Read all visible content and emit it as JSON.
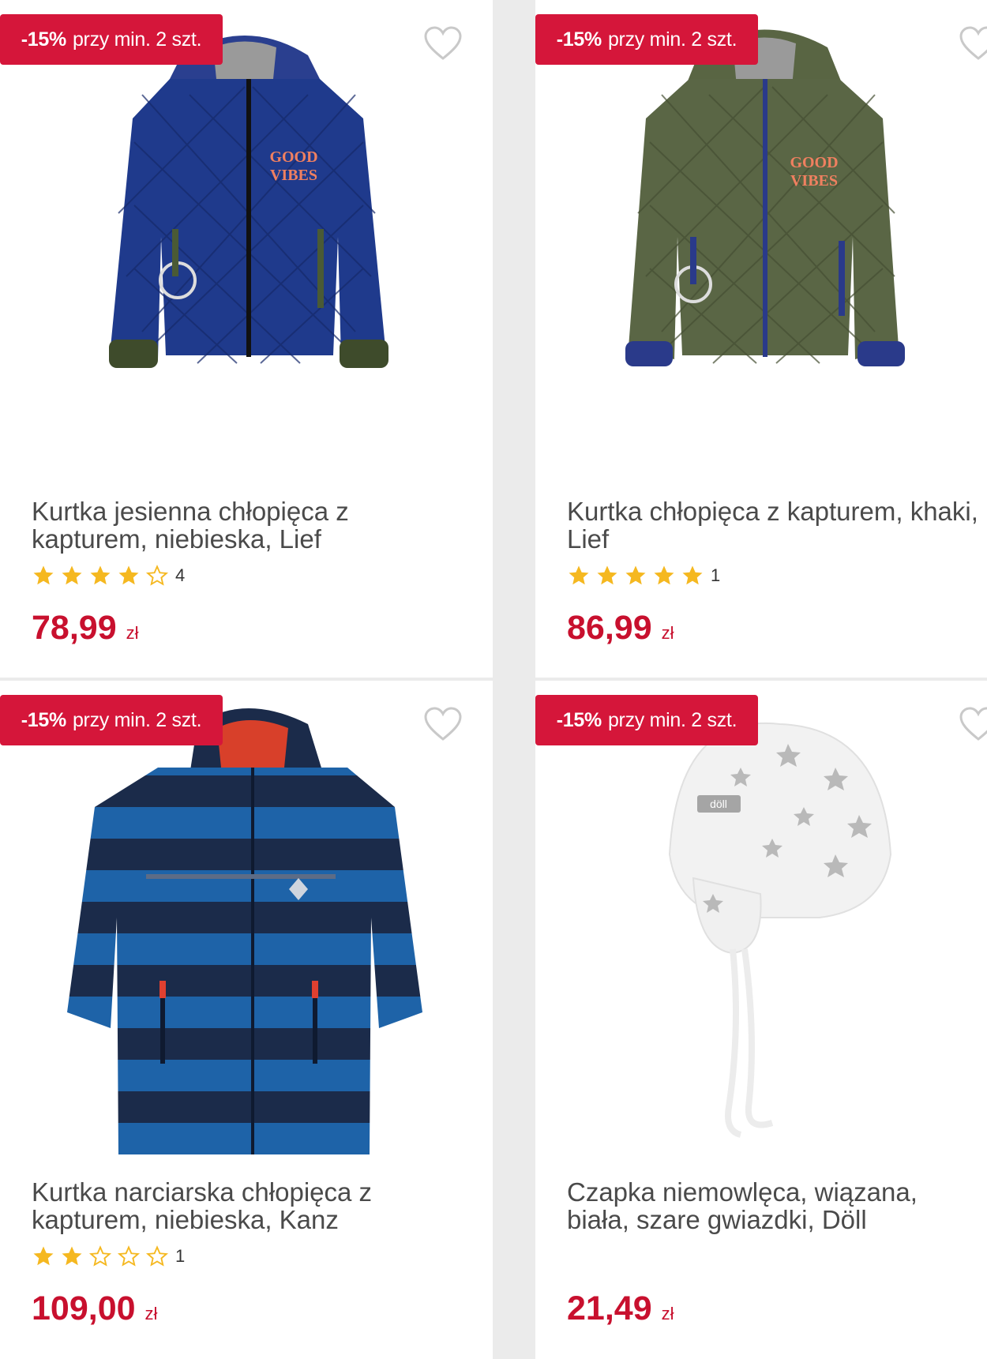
{
  "badge": {
    "pct": "-15%",
    "text": "przy min. 2 szt."
  },
  "colors": {
    "accent": "#d5163a",
    "price": "#c8102e",
    "star": "#f5b820"
  },
  "products": [
    {
      "title_line1": "Kurtka jesienna chłopięca z",
      "title_line2": "kapturem, niebieska, Lief",
      "rating": 4,
      "rating_count": "4",
      "price": "78,99",
      "currency": "zł",
      "image": "navy-quilted-jacket"
    },
    {
      "title_line1": "Kurtka chłopięca z kapturem, khaki,",
      "title_line2": "Lief",
      "rating": 5,
      "rating_count": "1",
      "price": "86,99",
      "currency": "zł",
      "image": "khaki-quilted-jacket"
    },
    {
      "title_line1": "Kurtka narciarska chłopięca z",
      "title_line2": "kapturem, niebieska, Kanz",
      "rating": 2,
      "rating_count": "1",
      "price": "109,00",
      "currency": "zł",
      "image": "striped-ski-jacket"
    },
    {
      "title_line1": "Czapka niemowlęca, wiązana,",
      "title_line2": "biała, szare gwiazdki, Döll",
      "price": "21,49",
      "currency": "zł",
      "image": "white-star-baby-hat"
    }
  ]
}
